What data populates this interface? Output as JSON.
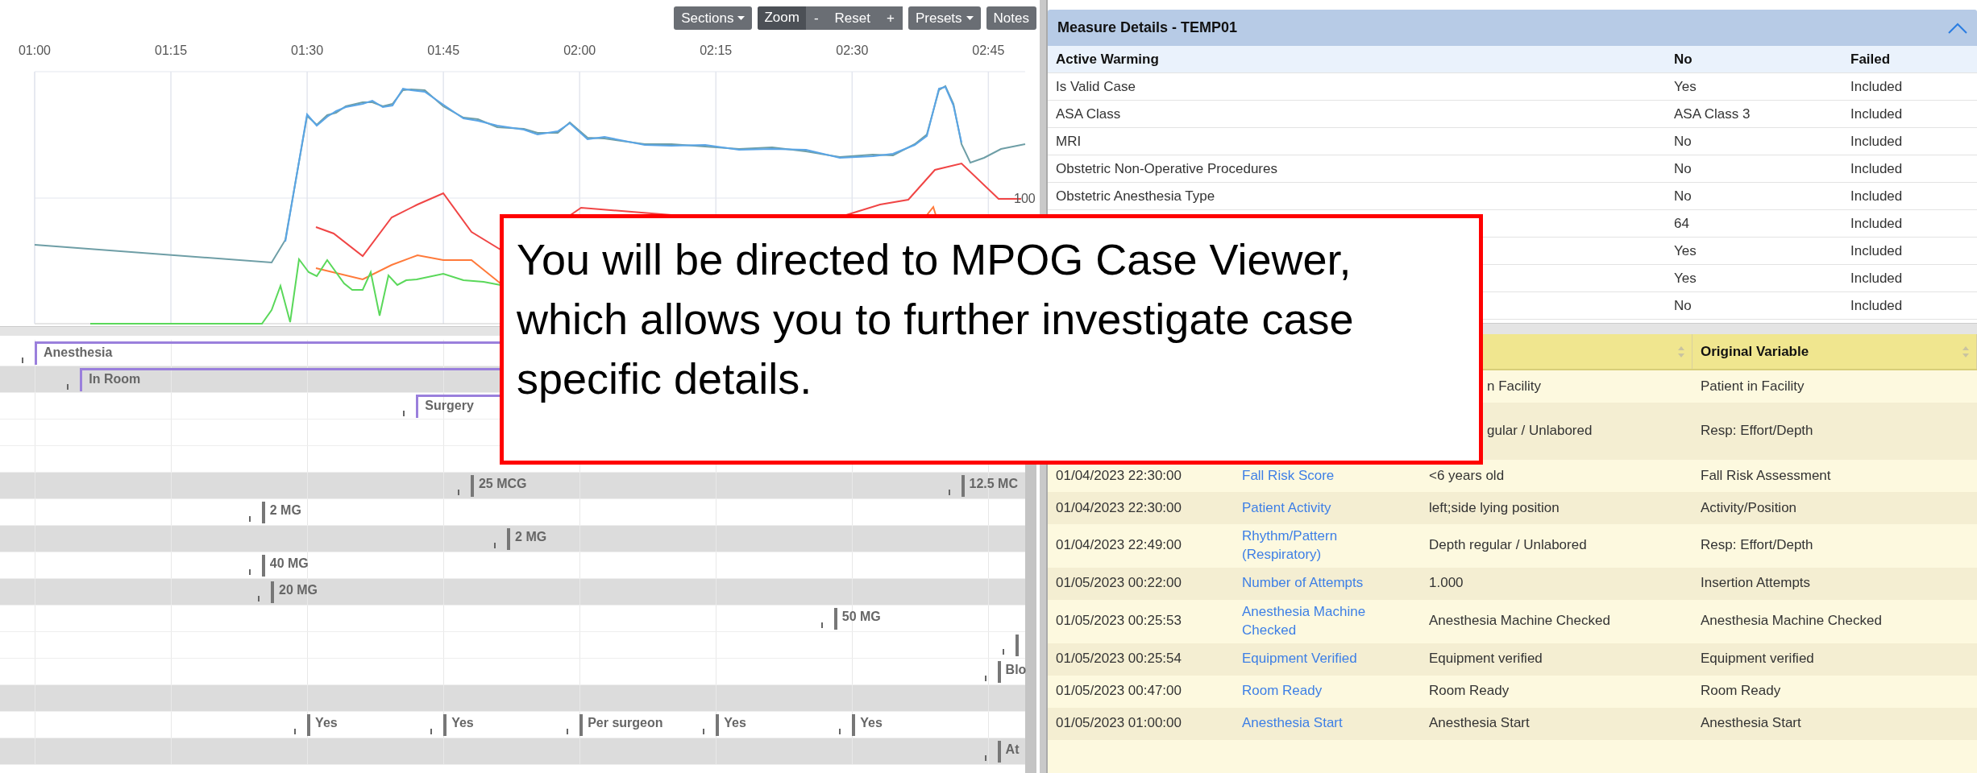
{
  "toolbar": [
    {
      "kind": "menu",
      "label": "Sections"
    },
    {
      "kind": "zoom",
      "label": "Zoom",
      "minus": "-",
      "reset": "Reset",
      "plus": "+"
    },
    {
      "kind": "menu",
      "label": "Presets"
    },
    {
      "kind": "button",
      "label": "Notes"
    }
  ],
  "chart": {
    "time_labels": [
      "01:00",
      "01:15",
      "01:30",
      "01:45",
      "02:00",
      "02:15",
      "02:30",
      "02:45"
    ],
    "scale_label": "100"
  },
  "timeline": {
    "rows": [
      {
        "shaded": false,
        "items": [
          {
            "kind": "interval",
            "label": "Anesthesia"
          }
        ]
      },
      {
        "shaded": true,
        "items": [
          {
            "kind": "interval",
            "label": "In Room"
          }
        ]
      },
      {
        "shaded": false,
        "items": [
          {
            "kind": "interval",
            "label": "Surgery"
          }
        ]
      },
      {
        "shaded": false,
        "items": []
      },
      {
        "shaded": false,
        "items": []
      },
      {
        "shaded": true,
        "items": [
          {
            "kind": "event",
            "label": "25 MCG"
          },
          {
            "kind": "event",
            "label": "12.5 MC"
          }
        ]
      },
      {
        "shaded": false,
        "items": [
          {
            "kind": "event",
            "label": "2 MG"
          }
        ]
      },
      {
        "shaded": true,
        "items": [
          {
            "kind": "event",
            "label": "2 MG"
          }
        ]
      },
      {
        "shaded": false,
        "items": [
          {
            "kind": "event",
            "label": "40 MG"
          }
        ]
      },
      {
        "shaded": true,
        "items": [
          {
            "kind": "event",
            "label": "20 MG"
          }
        ]
      },
      {
        "shaded": false,
        "items": [
          {
            "kind": "event",
            "label": "50 MG"
          }
        ]
      },
      {
        "shaded": false,
        "items": [
          {
            "kind": "event"
          }
        ]
      },
      {
        "shaded": false,
        "items": [
          {
            "kind": "event",
            "label": "Blo"
          }
        ]
      },
      {
        "shaded": true,
        "items": []
      },
      {
        "shaded": false,
        "items": [
          {
            "kind": "event",
            "label": "Yes"
          },
          {
            "kind": "event",
            "label": "Yes"
          },
          {
            "kind": "event",
            "label": "Per surgeon"
          },
          {
            "kind": "event",
            "label": "Yes"
          },
          {
            "kind": "event",
            "label": "Yes"
          }
        ]
      },
      {
        "shaded": true,
        "items": [
          {
            "kind": "event",
            "label": "At"
          }
        ]
      }
    ]
  },
  "measure_details": {
    "title": "Measure Details - TEMP01",
    "header": {
      "name": "Active Warming",
      "value": "No",
      "result": "Failed"
    },
    "rows": [
      {
        "name": "Is Valid Case",
        "value": "Yes",
        "result": "Included"
      },
      {
        "name": "ASA Class",
        "value": "ASA Class 3",
        "result": "Included"
      },
      {
        "name": "MRI",
        "value": "No",
        "result": "Included"
      },
      {
        "name": "Obstetric Non-Operative Procedures",
        "value": "No",
        "result": "Included"
      },
      {
        "name": "Obstetric Anesthesia Type",
        "value": "No",
        "result": "Included"
      },
      {
        "value": "64",
        "result": "Included"
      },
      {
        "value": "Yes",
        "result": "Included"
      },
      {
        "value": "Yes",
        "result": "Included"
      },
      {
        "value": "No",
        "result": "Included"
      }
    ]
  },
  "event_table": {
    "columns": [
      {
        "sortable": true
      },
      {
        "label": "Original Variable",
        "sortable": true
      }
    ],
    "rows": [
      {
        "value": "n Facility",
        "value_cut": true,
        "original": "Patient in Facility"
      },
      {
        "value": "gular / Unlabored",
        "value_cut": true,
        "original": "Resp: Effort/Depth"
      },
      {
        "time": "01/04/2023 22:30:00",
        "variable": "Fall Risk Score",
        "value": "<6 years old",
        "original": "Fall Risk Assessment"
      },
      {
        "time": "01/04/2023 22:30:00",
        "variable": "Patient Activity",
        "value": "left;side lying position",
        "original": "Activity/Position"
      },
      {
        "time": "01/04/2023 22:49:00",
        "variable": "Rhythm/Pattern (Respiratory)",
        "value": "Depth regular / Unlabored",
        "original": "Resp: Effort/Depth"
      },
      {
        "time": "01/05/2023 00:22:00",
        "variable": "Number of Attempts",
        "value": "1.000",
        "original": "Insertion Attempts"
      },
      {
        "time": "01/05/2023 00:25:53",
        "variable": "Anesthesia Machine Checked",
        "value": "Anesthesia Machine Checked",
        "original": "Anesthesia Machine Checked"
      },
      {
        "time": "01/05/2023 00:25:54",
        "variable": "Equipment Verified",
        "value": "Equipment verified",
        "original": "Equipment verified"
      },
      {
        "time": "01/05/2023 00:47:00",
        "variable": "Room Ready",
        "value": "Room Ready",
        "original": "Room Ready"
      },
      {
        "time": "01/05/2023 01:00:00",
        "variable": "Anesthesia Start",
        "value": "Anesthesia Start",
        "original": "Anesthesia Start"
      }
    ]
  },
  "callout": {
    "text": "You will be directed to MPOG Case Viewer, which allows you to further investigate case specific details."
  }
}
